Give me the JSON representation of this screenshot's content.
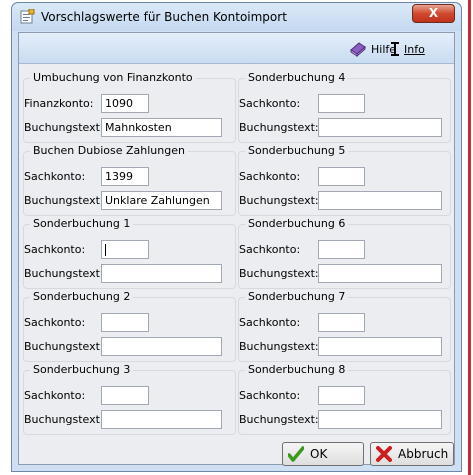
{
  "window": {
    "title": "Vorschlagswerte für Buchen Kontoimport",
    "close_glyph": "X"
  },
  "toolbar": {
    "hilfe": {
      "label": "Hilfe",
      "icon": "help-book-icon"
    },
    "info": {
      "label": "Info",
      "icon": "info-icon"
    }
  },
  "groups": {
    "umbuchung": {
      "title": "Umbuchung von Finanzkonto",
      "row1_label": "Finanzkonto:",
      "row1_value": "1090",
      "row2_label": "Buchungstext:",
      "row2_value": "Mahnkosten"
    },
    "dubiose": {
      "title": "Buchen Dubiose Zahlungen",
      "row1_label": "Sachkonto:",
      "row1_value": "1399",
      "row2_label": "Buchungstext:",
      "row2_value": "Unklare Zahlungen"
    },
    "sb1": {
      "title": "Sonderbuchung 1",
      "row1_label": "Sachkonto:",
      "row1_value": "",
      "row2_label": "Buchungstext:",
      "row2_value": ""
    },
    "sb2": {
      "title": "Sonderbuchung 2",
      "row1_label": "Sachkonto:",
      "row1_value": "",
      "row2_label": "Buchungstext:",
      "row2_value": ""
    },
    "sb3": {
      "title": "Sonderbuchung 3",
      "row1_label": "Sachkonto:",
      "row1_value": "",
      "row2_label": "Buchungstext:",
      "row2_value": ""
    },
    "sb4": {
      "title": "Sonderbuchung 4",
      "row1_label": "Sachkonto:",
      "row1_value": "",
      "row2_label": "Buchungstext:",
      "row2_value": ""
    },
    "sb5": {
      "title": "Sonderbuchung 5",
      "row1_label": "Sachkonto:",
      "row1_value": "",
      "row2_label": "Buchungstext:",
      "row2_value": ""
    },
    "sb6": {
      "title": "Sonderbuchung 6",
      "row1_label": "Sachkonto:",
      "row1_value": "",
      "row2_label": "Buchungstext:",
      "row2_value": ""
    },
    "sb7": {
      "title": "Sonderbuchung 7",
      "row1_label": "Sachkonto:",
      "row1_value": "",
      "row2_label": "Buchungstext:",
      "row2_value": ""
    },
    "sb8": {
      "title": "Sonderbuchung 8",
      "row1_label": "Sachkonto:",
      "row1_value": "",
      "row2_label": "Buchungstext:",
      "row2_value": ""
    }
  },
  "buttons": {
    "ok": {
      "label": "OK",
      "icon": "checkmark-icon"
    },
    "abbruch": {
      "label": "Abbruch",
      "icon": "cross-icon"
    }
  },
  "colors": {
    "title_bar": "#c4d8ef",
    "close_button": "#c9402a",
    "ok_check": "#3a9a1c",
    "cancel_cross": "#cc1f1f",
    "dialog_bg": "#ecedf0"
  }
}
